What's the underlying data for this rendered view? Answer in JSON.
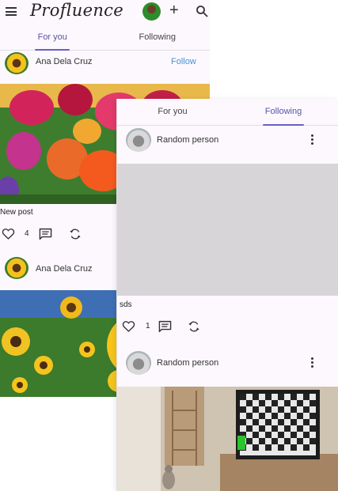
{
  "app": {
    "title": "Profluence"
  },
  "tabs": {
    "for_you": "For you",
    "following": "Following"
  },
  "screen_a": {
    "posts": [
      {
        "author": "Ana Dela Cruz",
        "follow_label": "Follow",
        "caption": "New post",
        "like_count": "4"
      },
      {
        "author": "Ana Dela Cruz"
      }
    ]
  },
  "screen_b": {
    "posts": [
      {
        "author": "Random person",
        "caption": "sds",
        "like_count": "1"
      },
      {
        "author": "Random person"
      }
    ]
  },
  "colors": {
    "accent": "#6a5fbf",
    "follow": "#4a90d9",
    "background": "#fcf8fd"
  },
  "icons": [
    "menu-icon",
    "add-icon",
    "search-icon",
    "heart-icon",
    "comment-icon",
    "repost-icon",
    "more-vert-icon"
  ]
}
